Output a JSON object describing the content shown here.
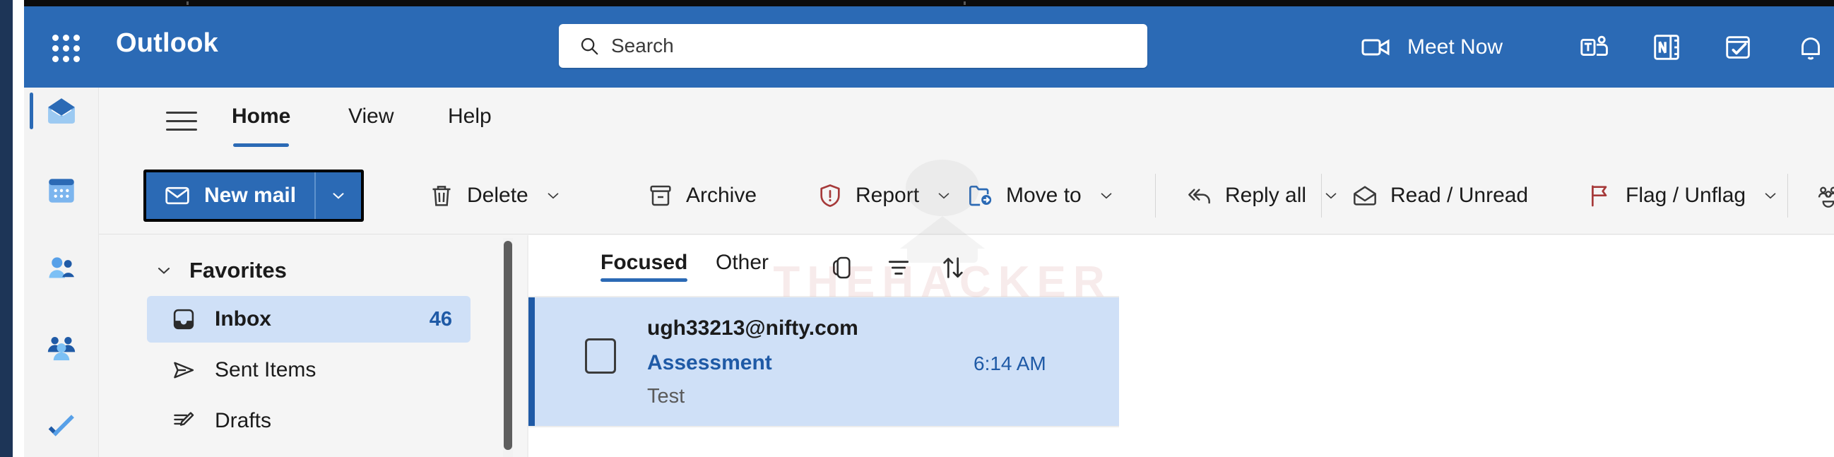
{
  "window": {
    "brand": "Outlook"
  },
  "header": {
    "waffle_icon": "app-launcher-waffle-icon",
    "search": {
      "placeholder": "Search",
      "value": "",
      "icon": "search-icon"
    },
    "meet_now": {
      "label": "Meet Now",
      "icon": "video-camera-icon"
    },
    "icons": [
      {
        "name": "teams-icon"
      },
      {
        "name": "onenote-icon"
      },
      {
        "name": "sticky-notes-icon"
      },
      {
        "name": "notifications-bell-icon"
      }
    ],
    "colors": {
      "header_blue": "#2b6ab5",
      "accent_blue": "#1f5aa6",
      "selection_blue": "#cfe0f7"
    }
  },
  "rail": {
    "items": [
      {
        "label": "Mail",
        "icon": "mail-icon",
        "selected": true
      },
      {
        "label": "Calendar",
        "icon": "calendar-icon",
        "selected": false
      },
      {
        "label": "People",
        "icon": "people-icon",
        "selected": false
      },
      {
        "label": "Groups",
        "icon": "groups-icon",
        "selected": false
      },
      {
        "label": "To Do",
        "icon": "checkmark-icon",
        "selected": false
      }
    ]
  },
  "ribbon": {
    "menu_icon": "hamburger-menu-icon",
    "tabs": [
      {
        "label": "Home",
        "active": true
      },
      {
        "label": "View",
        "active": false
      },
      {
        "label": "Help",
        "active": false
      }
    ],
    "new_mail": {
      "label": "New mail",
      "icon": "envelope-icon",
      "caret_icon": "chevron-down-icon",
      "focused": true
    },
    "commands": [
      {
        "label": "Delete",
        "icon": "trash-icon",
        "has_caret": true
      },
      {
        "label": "Archive",
        "icon": "archive-box-icon",
        "has_caret": false
      },
      {
        "label": "Report",
        "icon": "report-shield-icon",
        "has_caret": true
      },
      {
        "label": "Move to",
        "icon": "move-to-folder-icon",
        "has_caret": true
      },
      {
        "label": "Reply all",
        "icon": "reply-all-icon",
        "has_caret": true
      },
      {
        "label": "Read / Unread",
        "icon": "open-envelope-icon",
        "has_caret": false
      },
      {
        "label": "Flag / Unflag",
        "icon": "flag-icon",
        "has_caret": true
      }
    ],
    "trailing_icons": [
      {
        "name": "group-people-icon",
        "disabled": false
      },
      {
        "name": "undo-arrow-icon",
        "disabled": true
      }
    ]
  },
  "folder_pane": {
    "favorites": {
      "label": "Favorites",
      "expanded": true,
      "chevron_icon": "chevron-down-icon"
    },
    "folders": [
      {
        "label": "Inbox",
        "icon": "inbox-icon",
        "count": "46",
        "selected": true
      },
      {
        "label": "Sent Items",
        "icon": "send-icon",
        "count": "",
        "selected": false
      },
      {
        "label": "Drafts",
        "icon": "drafts-pencil-icon",
        "count": "",
        "selected": false
      }
    ],
    "scrollbar": "folder-pane-scrollbar"
  },
  "message_list": {
    "pivots": [
      {
        "label": "Focused",
        "active": true
      },
      {
        "label": "Other",
        "active": false
      }
    ],
    "toolbar_icons": [
      {
        "name": "conversation-view-icon"
      },
      {
        "name": "filter-icon"
      },
      {
        "name": "sort-icon"
      }
    ],
    "messages": [
      {
        "sender": "ugh33213@nifty.com",
        "subject": "Assessment",
        "preview": "Test",
        "time": "6:14 AM",
        "unread": true,
        "selected": true,
        "checkbox_icon": "message-checkbox"
      }
    ]
  },
  "watermark": {
    "text": "THEHACKER"
  }
}
